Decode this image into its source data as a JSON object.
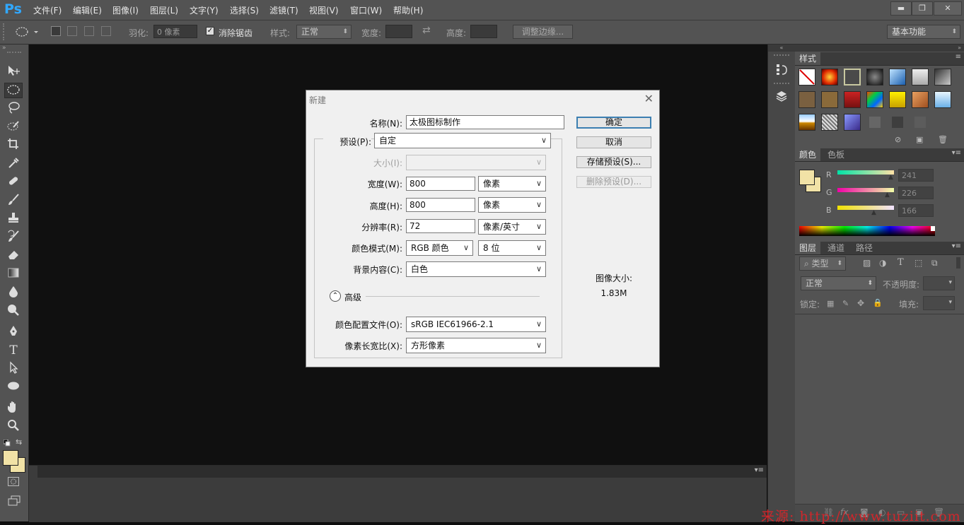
{
  "app": {
    "logo": "Ps"
  },
  "menu": [
    "文件(F)",
    "编辑(E)",
    "图像(I)",
    "图层(L)",
    "文字(Y)",
    "选择(S)",
    "滤镜(T)",
    "视图(V)",
    "窗口(W)",
    "帮助(H)"
  ],
  "window_controls": {
    "minimize": "▬",
    "restore": "❐",
    "close": "✕"
  },
  "options_bar": {
    "feather_label": "羽化:",
    "feather_value": "0 像素",
    "antialias_label": "消除锯齿",
    "antialias_checked": true,
    "style_label": "样式:",
    "style_value": "正常",
    "width_label": "宽度:",
    "width_value": "",
    "height_label": "高度:",
    "height_value": "",
    "refine_edge_label": "调整边缘...",
    "workspace_value": "基本功能"
  },
  "toolbar": {
    "tools": [
      "move",
      "elliptical-marquee",
      "lasso",
      "quick-selection",
      "crop",
      "eyedropper",
      "spot-healing",
      "brush",
      "clone-stamp",
      "history-brush",
      "eraser",
      "gradient",
      "blur",
      "dodge",
      "pen",
      "type",
      "path-selection",
      "ellipse-shape",
      "hand",
      "zoom"
    ],
    "type_tool_glyph": "T",
    "foreground_color": "#f1e2a6",
    "background_color": "#f1e2a6"
  },
  "styles_panel": {
    "tab": "样式"
  },
  "color_panel": {
    "tabs": [
      "颜色",
      "色板"
    ],
    "channels": [
      {
        "label": "R",
        "value": "241"
      },
      {
        "label": "G",
        "value": "226"
      },
      {
        "label": "B",
        "value": "166"
      }
    ],
    "swatch_color": "#f1e2a6"
  },
  "layers_panel": {
    "tabs": [
      "图层",
      "通道",
      "路径"
    ],
    "filter_label": "类型",
    "blend_mode": "正常",
    "opacity_label": "不透明度:",
    "lock_label": "锁定:",
    "fill_label": "填充:"
  },
  "dialog": {
    "title": "新建",
    "name_label": "名称(N):",
    "name_value": "太极图标制作",
    "preset_label": "预设(P):",
    "preset_value": "自定",
    "size_label": "大小(I):",
    "size_value": "",
    "width_label": "宽度(W):",
    "width_value": "800",
    "width_unit": "像素",
    "height_label": "高度(H):",
    "height_value": "800",
    "height_unit": "像素",
    "resolution_label": "分辨率(R):",
    "resolution_value": "72",
    "resolution_unit": "像素/英寸",
    "color_mode_label": "颜色模式(M):",
    "color_mode_value": "RGB 颜色",
    "bit_depth_value": "8 位",
    "background_label": "背景内容(C):",
    "background_value": "白色",
    "advanced_label": "高级",
    "profile_label": "颜色配置文件(O):",
    "profile_value": "sRGB IEC61966-2.1",
    "aspect_label": "像素长宽比(X):",
    "aspect_value": "方形像素",
    "ok_label": "确定",
    "cancel_label": "取消",
    "save_preset_label": "存储预设(S)...",
    "delete_preset_label": "删除预设(D)...",
    "image_size_label": "图像大小:",
    "image_size_value": "1.83M"
  },
  "watermark": "来源: http://www.tuziit.com"
}
